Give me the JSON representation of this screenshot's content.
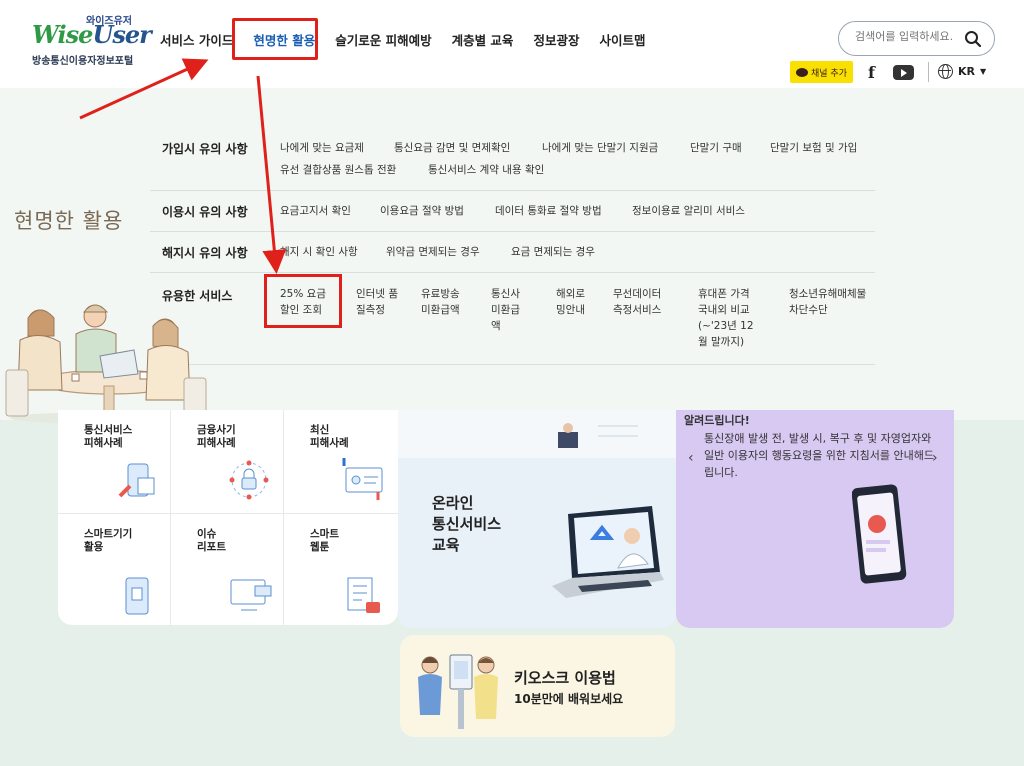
{
  "header": {
    "logo_small": "와이즈유저",
    "logo_mark_1": "Wise",
    "logo_mark_2": "User",
    "logo_sub": "방송통신이용자정보포털",
    "nav": [
      "서비스 가이드",
      "현명한 활용",
      "슬기로운 피해예방",
      "계층별 교육",
      "정보광장",
      "사이트맵"
    ],
    "active_nav": "현명한 활용",
    "search_placeholder": "검색어를 입력하세요.",
    "kakao_label": "채널 추가",
    "facebook_label": "f",
    "lang_label": "KR",
    "lang_caret": "▼",
    "colors": {
      "active": "#1a5fb4",
      "highlight": "#e0211b",
      "kakao": "#f9e000"
    }
  },
  "mega": {
    "title": "현명한 활용",
    "rows": [
      {
        "label": "가입시 유의 사항",
        "links": [
          "나에게 맞는 요금제",
          "통신요금 감면 및 면제확인",
          "나에게 맞는 단말기 지원금",
          "단말기 구매",
          "단말기 보험 및 가입",
          "유선 결합상품 원스톱 전환",
          "통신서비스 계약 내용 확인"
        ]
      },
      {
        "label": "이용시 유의 사항",
        "links": [
          "요금고지서 확인",
          "이용요금 절약 방법",
          "데이터 통화료 절약 방법",
          "정보이용료 알리미 서비스"
        ]
      },
      {
        "label": "해지시 유의 사항",
        "links": [
          "해지 시 확인 사항",
          "위약금 면제되는 경우",
          "요금 면제되는 경우"
        ]
      },
      {
        "label": "유용한 서비스",
        "links": [
          "25% 요금 할인 조회",
          "인터넷 품질측정",
          "유료방송 미환급액",
          "통신사 미환급액",
          "해외로 밍안내",
          "무선데이터 측정서비스",
          "휴대폰 가격 국내외 비교 (~'23년 12월 말까지)",
          "청소년유해매체물 차단수단"
        ]
      }
    ]
  },
  "cards": {
    "grid": [
      {
        "title": "통신서비스\n피해사례",
        "icon": "phone-cursor-icon"
      },
      {
        "title": "금융사기\n피해사례",
        "icon": "lock-network-icon"
      },
      {
        "title": "최신\n피해사례",
        "icon": "id-card-icon"
      },
      {
        "title": "스마트기기\n활용",
        "icon": "smartphone-icon"
      },
      {
        "title": "이슈\n리포트",
        "icon": "monitor-icon"
      },
      {
        "title": "스마트\n웹툰",
        "icon": "checklist-icon"
      }
    ],
    "online_title": "온라인\n통신서비스\n교육",
    "guide_title_partial": "알려드립니다!",
    "guide_text": "통신장애 발생 전, 발생 시, 복구 후 및 자영업자와 일반 이용자의 행동요령을 위한 지침서를 안내해드립니다.",
    "kiosk_title": "키오스크 이용법",
    "kiosk_sub": "10분만에 배워보세요"
  }
}
